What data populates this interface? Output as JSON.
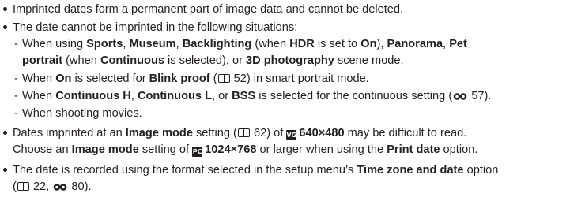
{
  "b1": {
    "text": "Imprinted dates form a permanent part of image data and cannot be deleted."
  },
  "b2": {
    "text": "The date cannot be imprinted in the following situations:",
    "s1": {
      "p1": "When using ",
      "sports": "Sports",
      "c1": ", ",
      "museum": "Museum",
      "c2": ", ",
      "backlighting": "Backlighting",
      "p2": " (when ",
      "hdr": "HDR",
      "p3": " is set to ",
      "on": "On",
      "p4": "), ",
      "panorama": "Panorama",
      "c3": ", ",
      "pet": "Pet",
      "portrait": "portrait",
      "p5": " (when ",
      "continuous": "Continuous",
      "p6": " is selected), or ",
      "photo3d": "3D photography",
      "p7": " scene mode."
    },
    "s2": {
      "p1": "When ",
      "on": "On",
      "p2": " is selected for ",
      "blink": "Blink proof",
      "p3": " (",
      "page": "52",
      "p4": ") in smart portrait mode."
    },
    "s3": {
      "p1": "When ",
      "conth": "Continuous H",
      "c1": ", ",
      "contl": "Continuous L",
      "p2": ", or ",
      "bss": "BSS",
      "p3": " is selected for the continuous setting (",
      "page": "57",
      "p4": ")."
    },
    "s4": {
      "text": "When shooting movies."
    }
  },
  "b3": {
    "p1": "Dates imprinted at an ",
    "imagemode": "Image mode",
    "p2": " setting (",
    "page": "62",
    "p3": ") of ",
    "icon1": "VGA",
    "res1": "640×480",
    "p4": " may be difficult to read.",
    "p5": "Choose an ",
    "imagemode2": "Image mode",
    "p6": " setting of ",
    "icon2": "PC",
    "res2": "1024×768",
    "p7": " or larger when using the ",
    "printdate": "Print date",
    "p8": " option."
  },
  "b4": {
    "p1": "The date is recorded using the format selected in the setup menu’s ",
    "tzd": "Time zone and date",
    "p2": " option",
    "p3": "(",
    "page1": "22",
    "p4": ", ",
    "page2": "80",
    "p5": ")."
  },
  "icons": [
    "bullet-icon",
    "dash-icon",
    "manual-book-icon",
    "link-chain-icon",
    "vga-image-mode-icon",
    "pc-image-mode-icon"
  ]
}
